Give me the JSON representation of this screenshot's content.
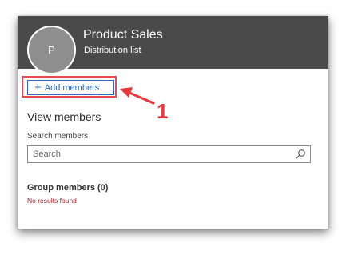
{
  "header": {
    "avatar_initial": "P",
    "title": "Product Sales",
    "subtitle": "Distribution list"
  },
  "toolbar": {
    "add_members_label": "Add members",
    "add_members_icon": "plus-icon"
  },
  "members": {
    "section_title": "View members",
    "search_label": "Search members",
    "search_placeholder": "Search",
    "search_value": "",
    "search_icon": "search-icon",
    "group_title": "Group members (0)",
    "empty_message": "No results found"
  },
  "annotation": {
    "callout_number": "1",
    "color": "#e8383d"
  },
  "colors": {
    "header_bg": "#4a4a4a",
    "accent": "#2b6cbe",
    "error": "#a4262c"
  }
}
